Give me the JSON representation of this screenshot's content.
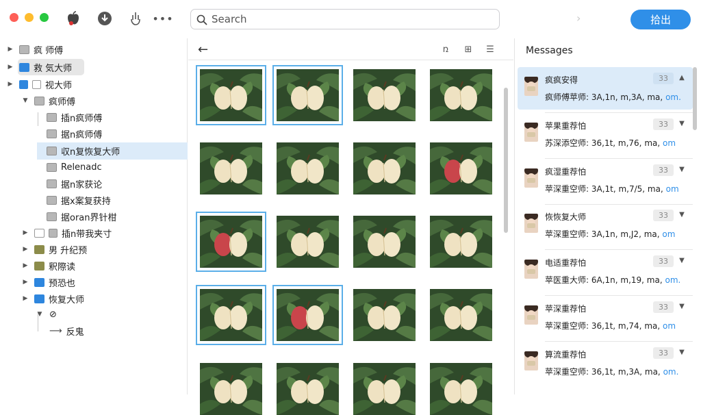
{
  "toolbar": {
    "search_placeholder": "Search",
    "primary_button": "拾出",
    "icons": [
      "apple-icon",
      "download-icon",
      "share-hand-icon",
      "more-icon"
    ],
    "colors": {
      "accent": "#2f8fe8",
      "close": "#fe5f57",
      "minimize": "#febc2e",
      "zoom": "#28c840"
    }
  },
  "sidebar": {
    "items": [
      {
        "label": "疯 师傅"
      },
      {
        "label": "救 気大师"
      },
      {
        "label": "视大师"
      },
      {
        "label": "疯师傅"
      },
      {
        "label": "插n疯师傅"
      },
      {
        "label": "据n疯师傅"
      },
      {
        "label": "収n复恢复大师"
      },
      {
        "label": "Relenadc"
      },
      {
        "label": "据n家获论"
      },
      {
        "label": "据x案复获持"
      },
      {
        "label": "据oran界针柑"
      },
      {
        "label": "插n带我夹寸"
      },
      {
        "label": "男 升纪预"
      },
      {
        "label": "釈際读"
      },
      {
        "label": "预恐也"
      },
      {
        "label": "恢复大师"
      },
      {
        "label": ""
      },
      {
        "label": "反鬼"
      }
    ]
  },
  "middle": {
    "toolbar_icons": [
      "back-arrow-icon",
      "crop-icon",
      "lock-icon",
      "list-view-icon"
    ]
  },
  "messages": {
    "title": "Messages",
    "items": [
      {
        "name": "疯疯安得",
        "count": "33",
        "preview": "疯师傅苹师: 3A,1n, m,3A, ma,",
        "link": "om.",
        "active": true
      },
      {
        "name": "苹果重荐怕",
        "count": "33",
        "preview": "苏深添空师: 36,1t, m,76, ma,",
        "link": "om",
        "active": false
      },
      {
        "name": "疯湿重荐怕",
        "count": "33",
        "preview": "苹深重空师: 3A,1t, m,7/5, ma,",
        "link": "om",
        "active": false
      },
      {
        "name": "恢恢复大师",
        "count": "33",
        "preview": "苹深重空师: 3A,1n, m,J2, ma,",
        "link": "om",
        "active": false
      },
      {
        "name": "电适重荐怕",
        "count": "33",
        "preview": "苹医重大师: 6A,1n, m,19, ma,",
        "link": "om.",
        "active": false
      },
      {
        "name": "苹深重荐怕",
        "count": "33",
        "preview": "苹深重空师: 36,1t, m,74, ma,",
        "link": "om",
        "active": false
      },
      {
        "name": "算流重荐怕",
        "count": "33",
        "preview": "苹深重空师: 36,1t, m,3A, ma,",
        "link": "om.",
        "active": false
      }
    ]
  }
}
